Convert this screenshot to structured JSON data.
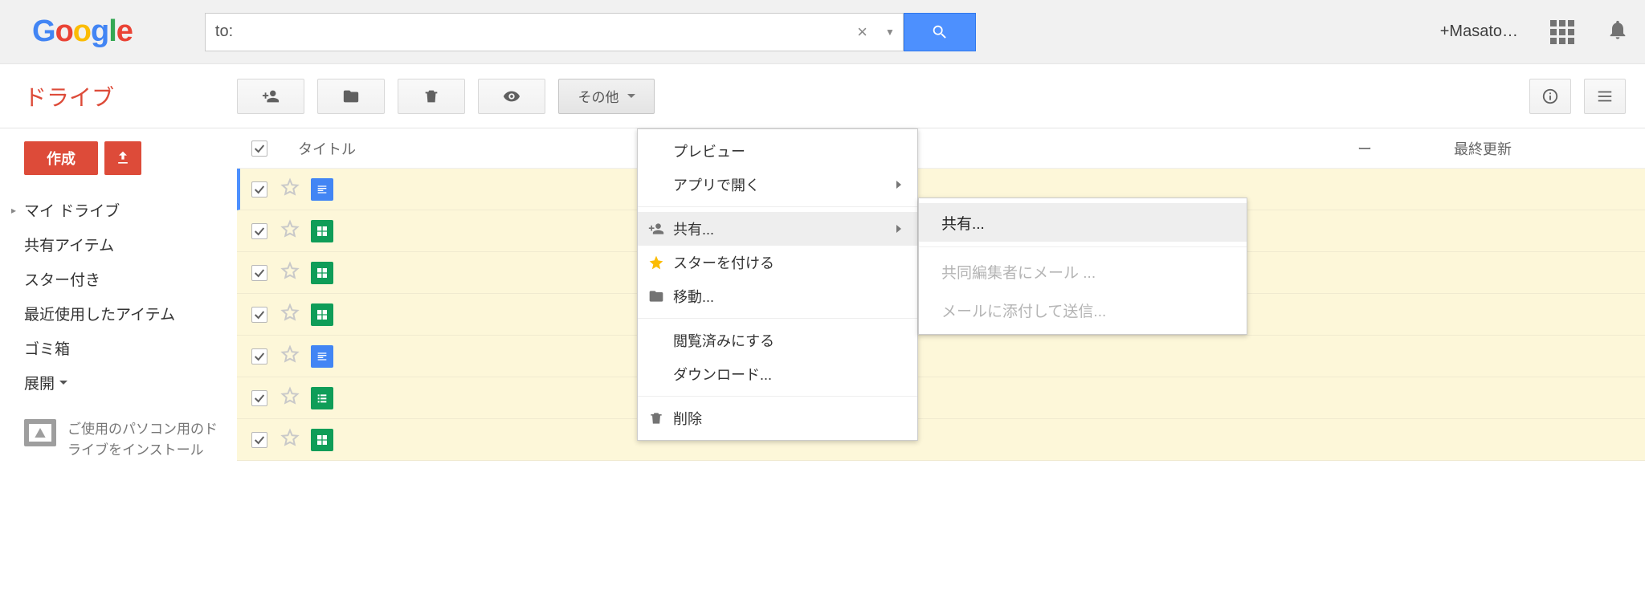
{
  "header": {
    "search_value": "to:",
    "profile_label": "+Masato…"
  },
  "product_name": "ドライブ",
  "toolbar": {
    "more_label": "その他"
  },
  "sidebar": {
    "create_label": "作成",
    "nav": [
      {
        "label": "マイ ドライブ",
        "expandable": true
      },
      {
        "label": "共有アイテム"
      },
      {
        "label": "スター付き"
      },
      {
        "label": "最近使用したアイテム"
      },
      {
        "label": "ゴミ箱"
      },
      {
        "label": "展開",
        "dropdown": true
      }
    ],
    "promo": "ご使用のパソコン用のドライブをインストール"
  },
  "list": {
    "col_title": "タイトル",
    "col_middle": "ー",
    "col_updated": "最終更新",
    "rows": [
      {
        "type": "doc",
        "checked": true,
        "selected": true
      },
      {
        "type": "sheet",
        "checked": true
      },
      {
        "type": "sheet",
        "checked": true
      },
      {
        "type": "sheet",
        "checked": true
      },
      {
        "type": "doc",
        "checked": true
      },
      {
        "type": "form",
        "checked": true
      },
      {
        "type": "sheet",
        "checked": true
      }
    ]
  },
  "menu": {
    "preview": "プレビュー",
    "open_with": "アプリで開く",
    "share": "共有...",
    "star": "スターを付ける",
    "move": "移動...",
    "mark_viewed": "閲覧済みにする",
    "download": "ダウンロード...",
    "delete": "削除"
  },
  "submenu": {
    "share": "共有...",
    "email_collab": "共同編集者にメール ...",
    "email_attach": "メールに添付して送信..."
  }
}
